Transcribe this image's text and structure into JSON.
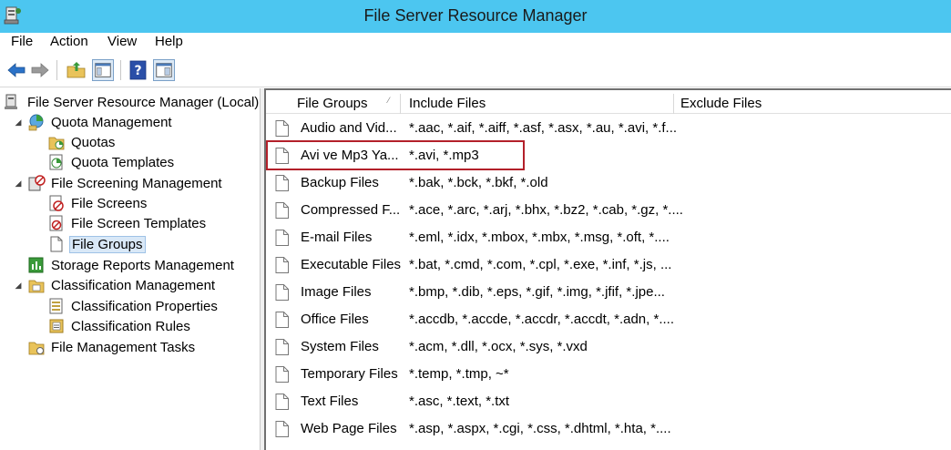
{
  "window": {
    "title": "File Server Resource Manager"
  },
  "menu": {
    "file": "File",
    "action": "Action",
    "view": "View",
    "help": "Help"
  },
  "toolbar": {
    "back_icon": "back-arrow-icon",
    "forward_icon": "forward-arrow-icon",
    "up_icon": "folder-up-icon",
    "show_hide_tree_icon": "show-hide-console-tree-icon",
    "help_icon": "help-icon",
    "action_pane_icon": "show-hide-action-pane-icon"
  },
  "tree": {
    "root": "File Server Resource Manager (Local)",
    "quota_management": "Quota Management",
    "quotas": "Quotas",
    "quota_templates": "Quota Templates",
    "file_screening_management": "File Screening Management",
    "file_screens": "File Screens",
    "file_screen_templates": "File Screen Templates",
    "file_groups": "File Groups",
    "storage_reports_management": "Storage Reports Management",
    "classification_management": "Classification Management",
    "classification_properties": "Classification Properties",
    "classification_rules": "Classification Rules",
    "file_management_tasks": "File Management Tasks"
  },
  "list": {
    "columns": [
      "File Groups",
      "Include Files",
      "Exclude Files"
    ],
    "rows": [
      {
        "name": "Audio and Vid...",
        "include": "*.aac, *.aif, *.aiff, *.asf, *.asx, *.au, *.avi, *.f...",
        "exclude": ""
      },
      {
        "name": "Avi ve Mp3 Ya...",
        "include": "*.avi, *.mp3",
        "exclude": ""
      },
      {
        "name": "Backup Files",
        "include": "*.bak, *.bck, *.bkf, *.old",
        "exclude": ""
      },
      {
        "name": "Compressed F...",
        "include": "*.ace, *.arc, *.arj, *.bhx, *.bz2, *.cab, *.gz, *....",
        "exclude": ""
      },
      {
        "name": "E-mail Files",
        "include": "*.eml, *.idx, *.mbox, *.mbx, *.msg, *.oft, *....",
        "exclude": ""
      },
      {
        "name": "Executable Files",
        "include": "*.bat, *.cmd, *.com, *.cpl, *.exe, *.inf, *.js, ...",
        "exclude": ""
      },
      {
        "name": "Image Files",
        "include": "*.bmp, *.dib, *.eps, *.gif, *.img, *.jfif, *.jpe...",
        "exclude": ""
      },
      {
        "name": "Office Files",
        "include": "*.accdb, *.accde, *.accdr, *.accdt, *.adn, *....",
        "exclude": ""
      },
      {
        "name": "System Files",
        "include": "*.acm, *.dll, *.ocx, *.sys, *.vxd",
        "exclude": ""
      },
      {
        "name": "Temporary Files",
        "include": "*.temp, *.tmp, ~*",
        "exclude": ""
      },
      {
        "name": "Text Files",
        "include": "*.asc, *.text, *.txt",
        "exclude": ""
      },
      {
        "name": "Web Page Files",
        "include": "*.asp, *.aspx, *.cgi, *.css, *.dhtml, *.hta, *....",
        "exclude": ""
      }
    ]
  },
  "colors": {
    "titlebar": "#4cc6f0",
    "highlight": "#b3202a",
    "selection": "#d9e8f7"
  }
}
